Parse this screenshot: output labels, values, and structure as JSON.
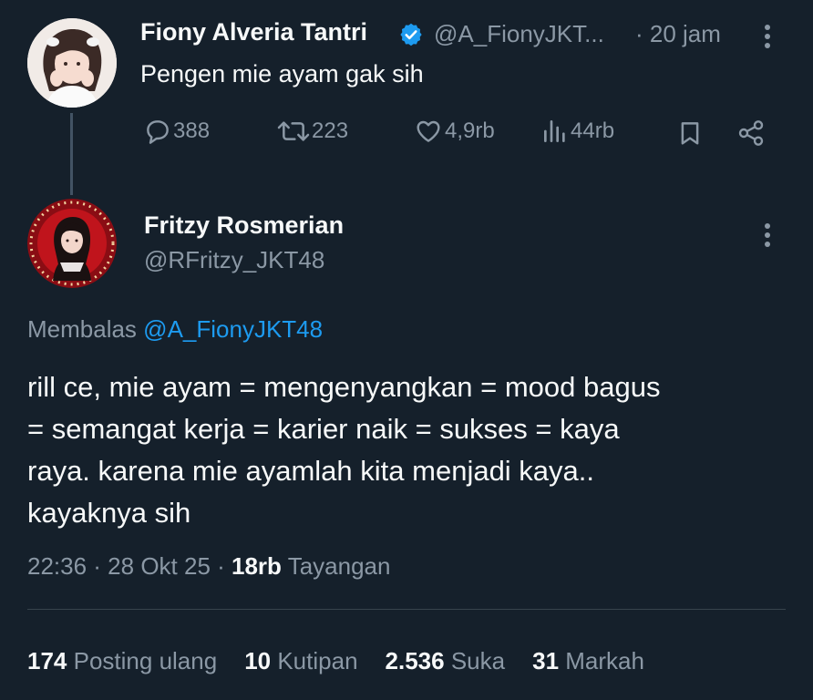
{
  "parent_tweet": {
    "author_name": "Fiony Alveria Tantri",
    "handle": "@A_FionyJKT...",
    "time": "· 20 jam",
    "text": "Pengen mie ayam gak sih",
    "metrics": {
      "replies": "388",
      "reposts": "223",
      "likes": "4,9rb",
      "views": "44rb"
    }
  },
  "reply_tweet": {
    "author_name": "Fritzy Rosmerian",
    "handle": "@RFritzy_JKT48",
    "replying_label": "Membalas",
    "replying_handle": "@A_FionyJKT48",
    "text_lines": [
      "rill ce, mie ayam = mengenyangkan = mood bagus",
      "= semangat kerja = karier naik = sukses = kaya",
      "raya. karena mie ayamlah kita menjadi kaya..",
      "kayaknya sih"
    ],
    "timestamp": "22:36 · 28 Okt 25 · ",
    "views_count": "18rb",
    "views_label": " Tayangan",
    "stats": [
      {
        "value": "174",
        "label": "Posting ulang"
      },
      {
        "value": "10",
        "label": "Kutipan"
      },
      {
        "value": "2.536",
        "label": "Suka"
      },
      {
        "value": "31",
        "label": "Markah"
      }
    ]
  },
  "colors": {
    "background": "#15202b",
    "text_primary": "#f7f9f9",
    "text_muted": "#8b98a5",
    "link": "#1d9bf0",
    "verified": "#1d9bf0"
  },
  "icons": [
    "verified-badge-icon",
    "more-icon",
    "reply-icon",
    "repost-icon",
    "like-icon",
    "views-icon",
    "bookmark-icon",
    "share-icon"
  ]
}
